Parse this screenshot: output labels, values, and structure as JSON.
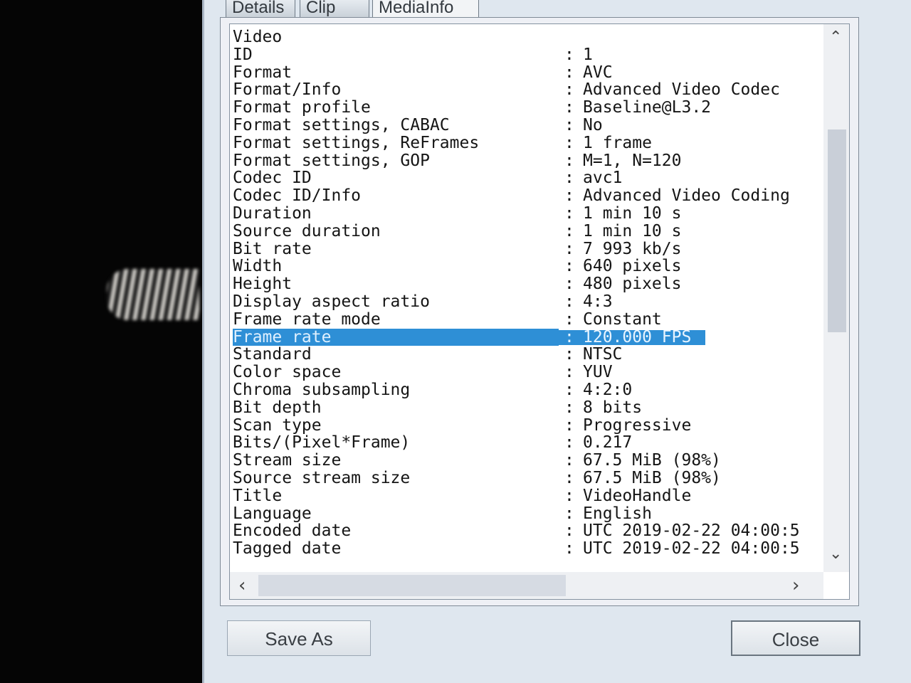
{
  "tabs": [
    {
      "label": "Details"
    },
    {
      "label": "Clip"
    },
    {
      "label": "MediaInfo"
    }
  ],
  "info": {
    "section": "Video",
    "rows": [
      {
        "label": "ID",
        "value": "1"
      },
      {
        "label": "Format",
        "value": "AVC"
      },
      {
        "label": "Format/Info",
        "value": "Advanced Video Codec"
      },
      {
        "label": "Format profile",
        "value": "Baseline@L3.2"
      },
      {
        "label": "Format settings, CABAC",
        "value": "No"
      },
      {
        "label": "Format settings, ReFrames",
        "value": "1 frame"
      },
      {
        "label": "Format settings, GOP",
        "value": "M=1, N=120"
      },
      {
        "label": "Codec ID",
        "value": "avc1"
      },
      {
        "label": "Codec ID/Info",
        "value": "Advanced Video Coding"
      },
      {
        "label": "Duration",
        "value": "1 min 10 s"
      },
      {
        "label": "Source duration",
        "value": "1 min 10 s"
      },
      {
        "label": "Bit rate",
        "value": "7 993 kb/s"
      },
      {
        "label": "Width",
        "value": "640 pixels"
      },
      {
        "label": "Height",
        "value": "480 pixels"
      },
      {
        "label": "Display aspect ratio",
        "value": "4:3"
      },
      {
        "label": "Frame rate mode",
        "value": "Constant"
      },
      {
        "label": "Frame rate",
        "value": "120.000 FPS"
      },
      {
        "label": "Standard",
        "value": "NTSC"
      },
      {
        "label": "Color space",
        "value": "YUV"
      },
      {
        "label": "Chroma subsampling",
        "value": "4:2:0"
      },
      {
        "label": "Bit depth",
        "value": "8 bits"
      },
      {
        "label": "Scan type",
        "value": "Progressive"
      },
      {
        "label": "Bits/(Pixel*Frame)",
        "value": "0.217"
      },
      {
        "label": "Stream size",
        "value": "67.5 MiB (98%)"
      },
      {
        "label": "Source stream size",
        "value": "67.5 MiB (98%)"
      },
      {
        "label": "Title",
        "value": "VideoHandle"
      },
      {
        "label": "Language",
        "value": "English"
      },
      {
        "label": "Encoded date",
        "value": "UTC 2019-02-22 04:00:5"
      },
      {
        "label": "Tagged date",
        "value": "UTC 2019-02-22 04:00:5"
      }
    ],
    "separator": ":",
    "selected_label": "Frame rate"
  },
  "buttons": {
    "save_as": "Save As",
    "close": "Close"
  },
  "colors": {
    "selection": "#2e8fd6",
    "window": "#dfe7ef"
  }
}
